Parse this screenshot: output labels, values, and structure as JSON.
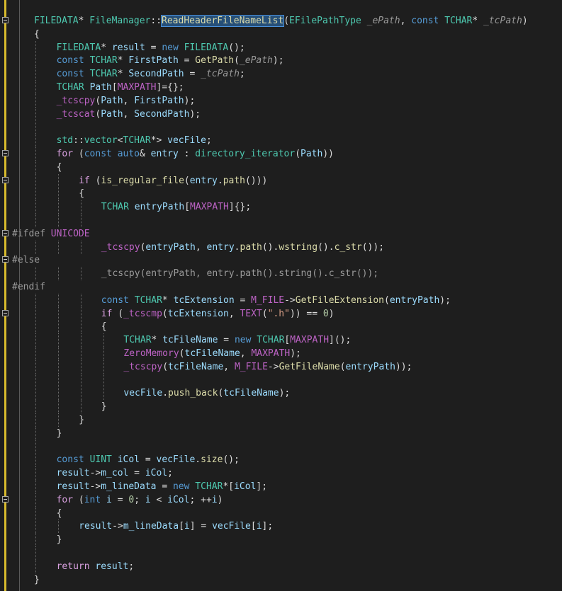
{
  "editor": {
    "lines": [
      {
        "indent": 1,
        "fold": true,
        "tokens": [
          {
            "t": "FILEDATA",
            "c": "t"
          },
          {
            "t": "* ",
            "c": ""
          },
          {
            "t": "FileManager",
            "c": "t"
          },
          {
            "t": "::",
            "c": ""
          },
          {
            "t": "ReadHeaderFileNameList",
            "c": "f sel"
          },
          {
            "t": "(",
            "c": ""
          },
          {
            "t": "EFilePathType",
            "c": "t"
          },
          {
            "t": " ",
            "c": ""
          },
          {
            "t": "_ePath",
            "c": "p"
          },
          {
            "t": ", ",
            "c": ""
          },
          {
            "t": "const",
            "c": "k"
          },
          {
            "t": " ",
            "c": ""
          },
          {
            "t": "TCHAR",
            "c": "t"
          },
          {
            "t": "* ",
            "c": ""
          },
          {
            "t": "_tcPath",
            "c": "p"
          },
          {
            "t": ")",
            "c": ""
          }
        ]
      },
      {
        "indent": 1,
        "tokens": [
          {
            "t": "{",
            "c": ""
          }
        ]
      },
      {
        "indent": 2,
        "tokens": [
          {
            "t": "FILEDATA",
            "c": "t"
          },
          {
            "t": "* ",
            "c": ""
          },
          {
            "t": "result",
            "c": "v"
          },
          {
            "t": " = ",
            "c": ""
          },
          {
            "t": "new",
            "c": "k"
          },
          {
            "t": " ",
            "c": ""
          },
          {
            "t": "FILEDATA",
            "c": "t"
          },
          {
            "t": "();",
            "c": ""
          }
        ]
      },
      {
        "indent": 2,
        "tokens": [
          {
            "t": "const",
            "c": "k"
          },
          {
            "t": " ",
            "c": ""
          },
          {
            "t": "TCHAR",
            "c": "t"
          },
          {
            "t": "* ",
            "c": ""
          },
          {
            "t": "FirstPath",
            "c": "v"
          },
          {
            "t": " = ",
            "c": ""
          },
          {
            "t": "GetPath",
            "c": "f"
          },
          {
            "t": "(",
            "c": ""
          },
          {
            "t": "_ePath",
            "c": "p"
          },
          {
            "t": ");",
            "c": ""
          }
        ]
      },
      {
        "indent": 2,
        "tokens": [
          {
            "t": "const",
            "c": "k"
          },
          {
            "t": " ",
            "c": ""
          },
          {
            "t": "TCHAR",
            "c": "t"
          },
          {
            "t": "* ",
            "c": ""
          },
          {
            "t": "SecondPath",
            "c": "v"
          },
          {
            "t": " = ",
            "c": ""
          },
          {
            "t": "_tcPath",
            "c": "p"
          },
          {
            "t": ";",
            "c": ""
          }
        ]
      },
      {
        "indent": 2,
        "tokens": [
          {
            "t": "TCHAR",
            "c": "t"
          },
          {
            "t": " ",
            "c": ""
          },
          {
            "t": "Path",
            "c": "v"
          },
          {
            "t": "[",
            "c": ""
          },
          {
            "t": "MAXPATH",
            "c": "m"
          },
          {
            "t": "]={};",
            "c": ""
          }
        ]
      },
      {
        "indent": 2,
        "tokens": [
          {
            "t": "_tcscpy",
            "c": "m"
          },
          {
            "t": "(",
            "c": ""
          },
          {
            "t": "Path",
            "c": "v"
          },
          {
            "t": ", ",
            "c": ""
          },
          {
            "t": "FirstPath",
            "c": "v"
          },
          {
            "t": ");",
            "c": ""
          }
        ]
      },
      {
        "indent": 2,
        "tokens": [
          {
            "t": "_tcscat",
            "c": "m"
          },
          {
            "t": "(",
            "c": ""
          },
          {
            "t": "Path",
            "c": "v"
          },
          {
            "t": ", ",
            "c": ""
          },
          {
            "t": "SecondPath",
            "c": "v"
          },
          {
            "t": ");",
            "c": ""
          }
        ]
      },
      {
        "indent": 2,
        "tokens": []
      },
      {
        "indent": 2,
        "tokens": [
          {
            "t": "std",
            "c": "t"
          },
          {
            "t": "::",
            "c": ""
          },
          {
            "t": "vector",
            "c": "t"
          },
          {
            "t": "<",
            "c": ""
          },
          {
            "t": "TCHAR",
            "c": "t"
          },
          {
            "t": "*> ",
            "c": ""
          },
          {
            "t": "vecFile",
            "c": "v"
          },
          {
            "t": ";",
            "c": ""
          }
        ]
      },
      {
        "indent": 2,
        "fold": true,
        "tokens": [
          {
            "t": "for",
            "c": "ctl"
          },
          {
            "t": " (",
            "c": ""
          },
          {
            "t": "const",
            "c": "k"
          },
          {
            "t": " ",
            "c": ""
          },
          {
            "t": "auto",
            "c": "k"
          },
          {
            "t": "& ",
            "c": ""
          },
          {
            "t": "entry",
            "c": "v"
          },
          {
            "t": " : ",
            "c": ""
          },
          {
            "t": "directory_iterator",
            "c": "t"
          },
          {
            "t": "(",
            "c": ""
          },
          {
            "t": "Path",
            "c": "v"
          },
          {
            "t": "))",
            "c": ""
          }
        ]
      },
      {
        "indent": 2,
        "tokens": [
          {
            "t": "{",
            "c": ""
          }
        ]
      },
      {
        "indent": 3,
        "fold": true,
        "tokens": [
          {
            "t": "if",
            "c": "ctl"
          },
          {
            "t": " (",
            "c": ""
          },
          {
            "t": "is_regular_file",
            "c": "f"
          },
          {
            "t": "(",
            "c": ""
          },
          {
            "t": "entry",
            "c": "v"
          },
          {
            "t": ".",
            "c": ""
          },
          {
            "t": "path",
            "c": "f"
          },
          {
            "t": "()))",
            "c": ""
          }
        ]
      },
      {
        "indent": 3,
        "tokens": [
          {
            "t": "{",
            "c": ""
          }
        ]
      },
      {
        "indent": 4,
        "tokens": [
          {
            "t": "TCHAR",
            "c": "t"
          },
          {
            "t": " ",
            "c": ""
          },
          {
            "t": "entryPath",
            "c": "v"
          },
          {
            "t": "[",
            "c": ""
          },
          {
            "t": "MAXPATH",
            "c": "m"
          },
          {
            "t": "]{};",
            "c": ""
          }
        ]
      },
      {
        "indent": 4,
        "tokens": []
      },
      {
        "indent": 0,
        "fold": true,
        "pre": true,
        "tokens": [
          {
            "t": "#ifdef",
            "c": "pp"
          },
          {
            "t": " ",
            "c": ""
          },
          {
            "t": "UNICODE",
            "c": "m"
          }
        ]
      },
      {
        "indent": 4,
        "tokens": [
          {
            "t": "_tcscpy",
            "c": "m"
          },
          {
            "t": "(",
            "c": ""
          },
          {
            "t": "entryPath",
            "c": "v"
          },
          {
            "t": ", ",
            "c": ""
          },
          {
            "t": "entry",
            "c": "v"
          },
          {
            "t": ".",
            "c": ""
          },
          {
            "t": "path",
            "c": "f"
          },
          {
            "t": "().",
            "c": ""
          },
          {
            "t": "wstring",
            "c": "f"
          },
          {
            "t": "().",
            "c": ""
          },
          {
            "t": "c_str",
            "c": "f"
          },
          {
            "t": "());",
            "c": ""
          }
        ]
      },
      {
        "indent": 0,
        "fold": true,
        "pre": true,
        "tokens": [
          {
            "t": "#else",
            "c": "pp"
          }
        ]
      },
      {
        "indent": 4,
        "tokens": [
          {
            "t": "_tcscpy(entryPath, entry.path().string().c_str());",
            "c": "gray"
          }
        ]
      },
      {
        "indent": 0,
        "pre": true,
        "tokens": [
          {
            "t": "#endif",
            "c": "pp"
          }
        ]
      },
      {
        "indent": 4,
        "tokens": [
          {
            "t": "const",
            "c": "k"
          },
          {
            "t": " ",
            "c": ""
          },
          {
            "t": "TCHAR",
            "c": "t"
          },
          {
            "t": "* ",
            "c": ""
          },
          {
            "t": "tcExtension",
            "c": "v"
          },
          {
            "t": " = ",
            "c": ""
          },
          {
            "t": "M_FILE",
            "c": "m"
          },
          {
            "t": "->",
            "c": ""
          },
          {
            "t": "GetFileExtension",
            "c": "f"
          },
          {
            "t": "(",
            "c": ""
          },
          {
            "t": "entryPath",
            "c": "v"
          },
          {
            "t": ");",
            "c": ""
          }
        ]
      },
      {
        "indent": 4,
        "fold": true,
        "tokens": [
          {
            "t": "if",
            "c": "ctl"
          },
          {
            "t": " (",
            "c": ""
          },
          {
            "t": "_tcscmp",
            "c": "m"
          },
          {
            "t": "(",
            "c": ""
          },
          {
            "t": "tcExtension",
            "c": "v"
          },
          {
            "t": ", ",
            "c": ""
          },
          {
            "t": "TEXT",
            "c": "m"
          },
          {
            "t": "(",
            "c": ""
          },
          {
            "t": "\".h\"",
            "c": "s"
          },
          {
            "t": ")) == ",
            "c": ""
          },
          {
            "t": "0",
            "c": "n"
          },
          {
            "t": ")",
            "c": ""
          }
        ]
      },
      {
        "indent": 4,
        "tokens": [
          {
            "t": "{",
            "c": ""
          }
        ]
      },
      {
        "indent": 5,
        "tokens": [
          {
            "t": "TCHAR",
            "c": "t"
          },
          {
            "t": "* ",
            "c": ""
          },
          {
            "t": "tcFileName",
            "c": "v"
          },
          {
            "t": " = ",
            "c": ""
          },
          {
            "t": "new",
            "c": "k"
          },
          {
            "t": " ",
            "c": ""
          },
          {
            "t": "TCHAR",
            "c": "t"
          },
          {
            "t": "[",
            "c": ""
          },
          {
            "t": "MAXPATH",
            "c": "m"
          },
          {
            "t": "]();",
            "c": ""
          }
        ]
      },
      {
        "indent": 5,
        "tokens": [
          {
            "t": "ZeroMemory",
            "c": "m"
          },
          {
            "t": "(",
            "c": ""
          },
          {
            "t": "tcFileName",
            "c": "v"
          },
          {
            "t": ", ",
            "c": ""
          },
          {
            "t": "MAXPATH",
            "c": "m"
          },
          {
            "t": ");",
            "c": ""
          }
        ]
      },
      {
        "indent": 5,
        "tokens": [
          {
            "t": "_tcscpy",
            "c": "m"
          },
          {
            "t": "(",
            "c": ""
          },
          {
            "t": "tcFileName",
            "c": "v"
          },
          {
            "t": ", ",
            "c": ""
          },
          {
            "t": "M_FILE",
            "c": "m"
          },
          {
            "t": "->",
            "c": ""
          },
          {
            "t": "GetFileName",
            "c": "f"
          },
          {
            "t": "(",
            "c": ""
          },
          {
            "t": "entryPath",
            "c": "v"
          },
          {
            "t": "));",
            "c": ""
          }
        ]
      },
      {
        "indent": 5,
        "tokens": []
      },
      {
        "indent": 5,
        "tokens": [
          {
            "t": "vecFile",
            "c": "v"
          },
          {
            "t": ".",
            "c": ""
          },
          {
            "t": "push_back",
            "c": "f"
          },
          {
            "t": "(",
            "c": ""
          },
          {
            "t": "tcFileName",
            "c": "v"
          },
          {
            "t": ");",
            "c": ""
          }
        ]
      },
      {
        "indent": 4,
        "tokens": [
          {
            "t": "}",
            "c": ""
          }
        ]
      },
      {
        "indent": 3,
        "tokens": [
          {
            "t": "}",
            "c": ""
          }
        ]
      },
      {
        "indent": 2,
        "tokens": [
          {
            "t": "}",
            "c": ""
          }
        ]
      },
      {
        "indent": 2,
        "tokens": []
      },
      {
        "indent": 2,
        "tokens": [
          {
            "t": "const",
            "c": "k"
          },
          {
            "t": " ",
            "c": ""
          },
          {
            "t": "UINT",
            "c": "t"
          },
          {
            "t": " ",
            "c": ""
          },
          {
            "t": "iCol",
            "c": "v"
          },
          {
            "t": " = ",
            "c": ""
          },
          {
            "t": "vecFile",
            "c": "v"
          },
          {
            "t": ".",
            "c": ""
          },
          {
            "t": "size",
            "c": "f"
          },
          {
            "t": "();",
            "c": ""
          }
        ]
      },
      {
        "indent": 2,
        "tokens": [
          {
            "t": "result",
            "c": "v"
          },
          {
            "t": "->",
            "c": ""
          },
          {
            "t": "m_col",
            "c": "v"
          },
          {
            "t": " = ",
            "c": ""
          },
          {
            "t": "iCol",
            "c": "v"
          },
          {
            "t": ";",
            "c": ""
          }
        ]
      },
      {
        "indent": 2,
        "tokens": [
          {
            "t": "result",
            "c": "v"
          },
          {
            "t": "->",
            "c": ""
          },
          {
            "t": "m_lineData",
            "c": "v"
          },
          {
            "t": " = ",
            "c": ""
          },
          {
            "t": "new",
            "c": "k"
          },
          {
            "t": " ",
            "c": ""
          },
          {
            "t": "TCHAR",
            "c": "t"
          },
          {
            "t": "*[",
            "c": ""
          },
          {
            "t": "iCol",
            "c": "v"
          },
          {
            "t": "];",
            "c": ""
          }
        ]
      },
      {
        "indent": 2,
        "fold": true,
        "tokens": [
          {
            "t": "for",
            "c": "ctl"
          },
          {
            "t": " (",
            "c": ""
          },
          {
            "t": "int",
            "c": "k"
          },
          {
            "t": " ",
            "c": ""
          },
          {
            "t": "i",
            "c": "v"
          },
          {
            "t": " = ",
            "c": ""
          },
          {
            "t": "0",
            "c": "n"
          },
          {
            "t": "; ",
            "c": ""
          },
          {
            "t": "i",
            "c": "v"
          },
          {
            "t": " < ",
            "c": ""
          },
          {
            "t": "iCol",
            "c": "v"
          },
          {
            "t": "; ++",
            "c": ""
          },
          {
            "t": "i",
            "c": "v"
          },
          {
            "t": ")",
            "c": ""
          }
        ]
      },
      {
        "indent": 2,
        "tokens": [
          {
            "t": "{",
            "c": ""
          }
        ]
      },
      {
        "indent": 3,
        "tokens": [
          {
            "t": "result",
            "c": "v"
          },
          {
            "t": "->",
            "c": ""
          },
          {
            "t": "m_lineData",
            "c": "v"
          },
          {
            "t": "[",
            "c": ""
          },
          {
            "t": "i",
            "c": "v"
          },
          {
            "t": "] = ",
            "c": ""
          },
          {
            "t": "vecFile",
            "c": "v"
          },
          {
            "t": "[",
            "c": ""
          },
          {
            "t": "i",
            "c": "v"
          },
          {
            "t": "];",
            "c": ""
          }
        ]
      },
      {
        "indent": 2,
        "tokens": [
          {
            "t": "}",
            "c": ""
          }
        ]
      },
      {
        "indent": 2,
        "tokens": []
      },
      {
        "indent": 2,
        "tokens": [
          {
            "t": "return",
            "c": "ctl"
          },
          {
            "t": " ",
            "c": ""
          },
          {
            "t": "result",
            "c": "v"
          },
          {
            "t": ";",
            "c": ""
          }
        ]
      },
      {
        "indent": 1,
        "tokens": [
          {
            "t": "}",
            "c": ""
          }
        ]
      }
    ]
  }
}
